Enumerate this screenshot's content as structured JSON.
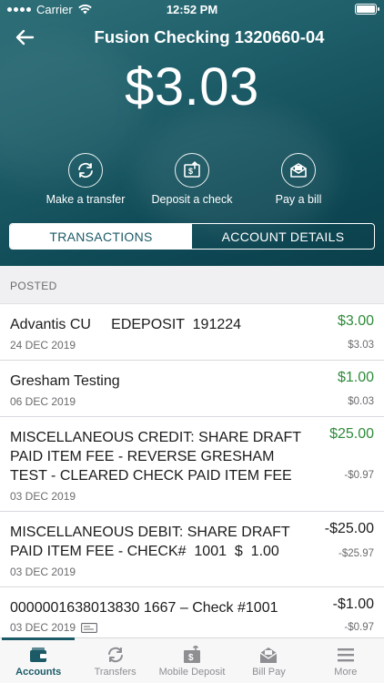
{
  "status_bar": {
    "carrier": "Carrier",
    "time": "12:52 PM"
  },
  "header": {
    "title": "Fusion Checking 1320660-04",
    "balance": "$3.03"
  },
  "actions": [
    {
      "label": "Make a transfer",
      "icon": "transfer-icon"
    },
    {
      "label": "Deposit a check",
      "icon": "deposit-check-icon"
    },
    {
      "label": "Pay a bill",
      "icon": "pay-bill-icon"
    }
  ],
  "tabs": {
    "transactions": "TRANSACTIONS",
    "account_details": "ACCOUNT DETAILS",
    "selected": "TRANSACTIONS"
  },
  "section": {
    "label": "POSTED"
  },
  "transactions": [
    {
      "description": "Advantis CU     EDEPOSIT  191224",
      "date": "24 DEC 2019",
      "amount": "$3.00",
      "balance": "$3.03",
      "type": "credit"
    },
    {
      "description": "Gresham Testing",
      "date": "06 DEC 2019",
      "amount": "$1.00",
      "balance": "$0.03",
      "type": "credit"
    },
    {
      "description": "MISCELLANEOUS CREDIT: SHARE DRAFT PAID ITEM FEE - REVERSE GRESHAM TEST - CLEARED CHECK PAID ITEM FEE",
      "date": "03 DEC 2019",
      "amount": "$25.00",
      "balance": "-$0.97",
      "type": "credit"
    },
    {
      "description": "MISCELLANEOUS DEBIT: SHARE DRAFT PAID ITEM FEE - CHECK#  1001  $  1.00",
      "date": "03 DEC 2019",
      "amount": "-$25.00",
      "balance": "-$25.97",
      "type": "debit"
    },
    {
      "description": "0000001638013830 1667 – Check #1001",
      "date": "03 DEC 2019",
      "amount": "-$1.00",
      "balance": "-$0.97",
      "type": "debit",
      "has_check_icon": true
    }
  ],
  "tabbar": [
    {
      "label": "Accounts",
      "icon": "accounts-icon",
      "active": true
    },
    {
      "label": "Transfers",
      "icon": "transfers-icon",
      "active": false
    },
    {
      "label": "Mobile Deposit",
      "icon": "mobile-deposit-icon",
      "active": false
    },
    {
      "label": "Bill Pay",
      "icon": "bill-pay-icon",
      "active": false
    },
    {
      "label": "More",
      "icon": "more-icon",
      "active": false
    }
  ],
  "colors": {
    "header_bg": "#1f5f6a",
    "accent": "#1b5a66",
    "credit": "#2e8b3a"
  }
}
